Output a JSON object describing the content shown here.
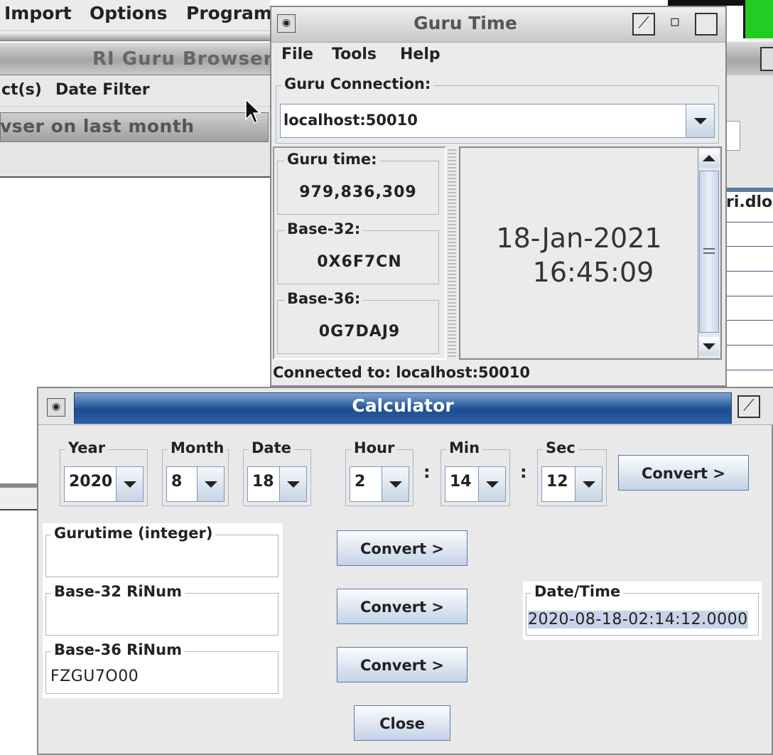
{
  "background_window": {
    "menu_items": [
      "Import",
      "Options",
      "Program"
    ],
    "title": "RI Guru Browser - (",
    "submenu_items": [
      "ct(s)",
      "Date Filter"
    ],
    "filter_text": "vser on last month",
    "right_table_header": "ri.dlo"
  },
  "guru_time": {
    "title": "Guru Time",
    "menu": [
      "File",
      "Tools",
      "Help"
    ],
    "connection_label": "Guru Connection:",
    "connection_value": "localhost:50010",
    "guru_time_label": "Guru time:",
    "guru_time_value": "979,836,309",
    "base32_label": "Base-32:",
    "base32_value": "0X6F7CN",
    "base36_label": "Base-36:",
    "base36_value": "0G7DAJ9",
    "clock_date": "18-Jan-2021",
    "clock_time": "16:45:09",
    "status": "Connected to: localhost:50010"
  },
  "calculator": {
    "title": "Calculator",
    "fields": {
      "year": {
        "label": "Year",
        "value": "2020"
      },
      "month": {
        "label": "Month",
        "value": "8"
      },
      "date": {
        "label": "Date",
        "value": "18"
      },
      "hour": {
        "label": "Hour",
        "value": "2"
      },
      "min": {
        "label": "Min",
        "value": "14"
      },
      "sec": {
        "label": "Sec",
        "value": "12"
      }
    },
    "colon": ":",
    "convert_label": "Convert >",
    "gurutime_label": "Gurutime (integer)",
    "gurutime_value": "",
    "base32_label": "Base-32 RiNum",
    "base32_value": "",
    "base36_label": "Base-36 RiNum",
    "base36_value": "FZGU7O00",
    "datetime_label": "Date/Time",
    "datetime_value": "2020-08-18-02:14:12.0000",
    "close_label": "Close"
  },
  "colors": {
    "calc_title_bar": "#1d4d8e",
    "green_indicator": "#22cc22",
    "selection": "#c5d4e8"
  }
}
